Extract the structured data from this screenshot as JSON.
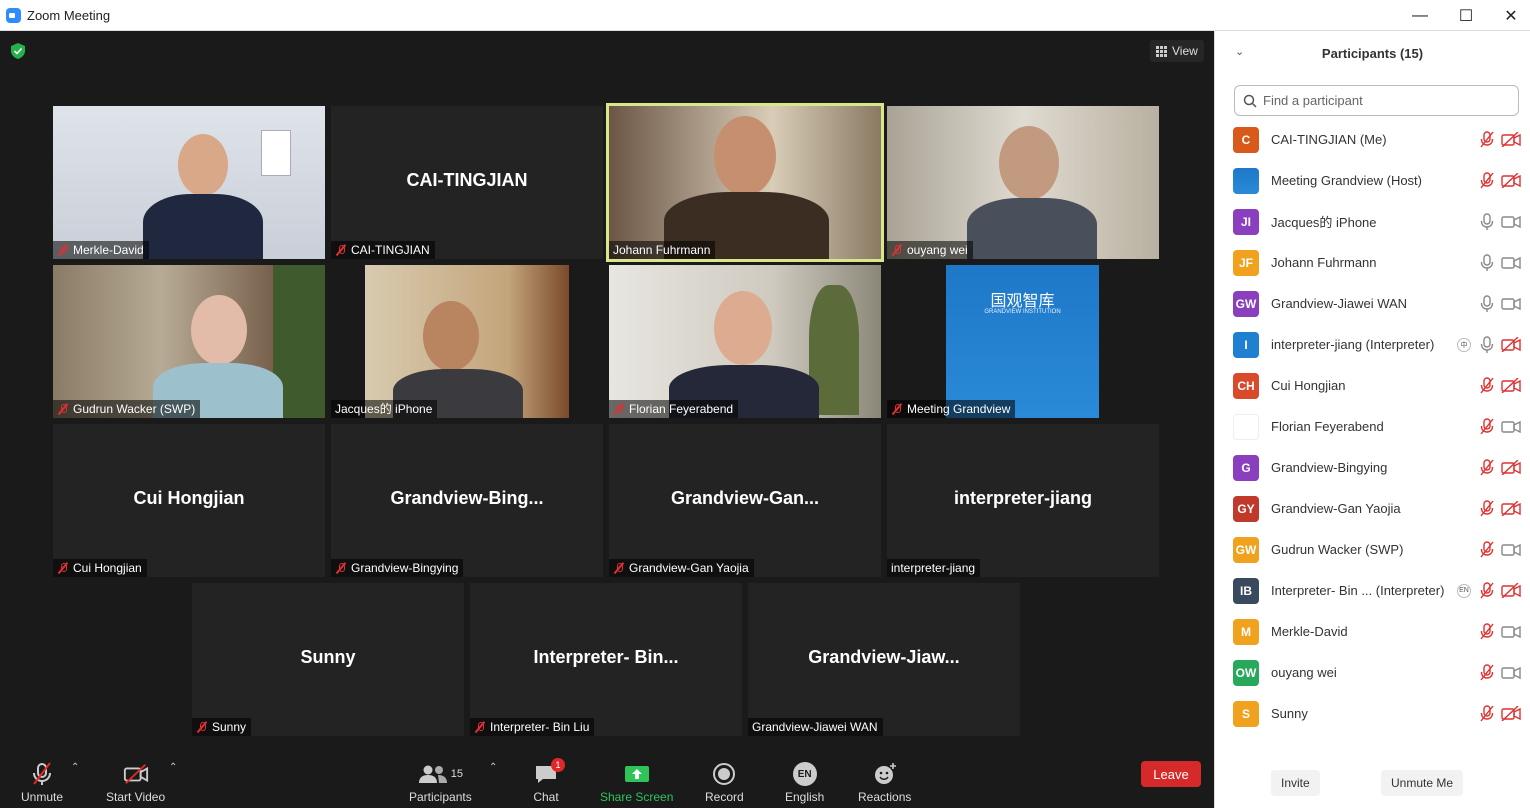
{
  "window": {
    "title": "Zoom Meeting"
  },
  "view": {
    "label": "View"
  },
  "tiles": [
    {
      "label": "Merkle-David",
      "big": ""
    },
    {
      "label": "CAI-TINGJIAN",
      "big": "CAI-TINGJIAN"
    },
    {
      "label": "Johann Fuhrmann",
      "big": ""
    },
    {
      "label": "ouyang wei",
      "big": ""
    },
    {
      "label": "Gudrun Wacker (SWP)",
      "big": ""
    },
    {
      "label": "Jacques的 iPhone",
      "big": ""
    },
    {
      "label": "Florian Feyerabend",
      "big": ""
    },
    {
      "label": "Meeting  Grandview",
      "big": ""
    },
    {
      "label": "Cui Hongjian",
      "big": "Cui Hongjian"
    },
    {
      "label": "Grandview-Bingying",
      "big": "Grandview-Bing..."
    },
    {
      "label": "Grandview-Gan Yaojia",
      "big": "Grandview-Gan..."
    },
    {
      "label": "interpreter-jiang",
      "big": "interpreter-jiang"
    },
    {
      "label": "Sunny",
      "big": "Sunny"
    },
    {
      "label": "Interpreter- Bin Liu",
      "big": "Interpreter-  Bin..."
    },
    {
      "label": "Grandview-Jiawei WAN",
      "big": "Grandview-Jiaw..."
    }
  ],
  "logo": {
    "title": "国观智库",
    "subtitle": "GRANDVIEW INSTITUTION"
  },
  "toolbar": {
    "unmute": "Unmute",
    "start_video": "Start Video",
    "participants": "Participants",
    "participants_count": "15",
    "chat": "Chat",
    "chat_badge": "1",
    "share": "Share Screen",
    "record": "Record",
    "english": "English",
    "english_icon": "EN",
    "reactions": "Reactions",
    "leave": "Leave"
  },
  "panel": {
    "title": "Participants (15)",
    "search_placeholder": "Find a participant",
    "invite": "Invite",
    "unmute_me": "Unmute Me",
    "participants": [
      {
        "initials": "C",
        "name": "CAI-TINGJIAN (Me)",
        "color": "#d9591b",
        "mic": "off",
        "cam": "off"
      },
      {
        "initials": "",
        "name": "Meeting  Grandview (Host)",
        "color": "#1f6fb5",
        "mic": "off",
        "cam": "off"
      },
      {
        "initials": "JI",
        "name": "Jacques的 iPhone",
        "color": "#8a3fbf",
        "mic": "on",
        "cam": "on"
      },
      {
        "initials": "JF",
        "name": "Johann Fuhrmann",
        "color": "#f0a21e",
        "mic": "on",
        "cam": "on"
      },
      {
        "initials": "GW",
        "name": "Grandview-Jiawei WAN",
        "color": "#8a3fbf",
        "mic": "on",
        "cam": "on"
      },
      {
        "initials": "I",
        "name": "interpreter-jiang (Interpreter)",
        "color": "#1f7fd1",
        "mic": "on",
        "cam": "off",
        "lang": "中"
      },
      {
        "initials": "CH",
        "name": "Cui Hongjian",
        "color": "#d94a2b",
        "mic": "off",
        "cam": "off"
      },
      {
        "initials": "",
        "name": "Florian Feyerabend",
        "color": "#ffffff",
        "mic": "off",
        "cam": "on"
      },
      {
        "initials": "G",
        "name": "Grandview-Bingying",
        "color": "#8a3fbf",
        "mic": "off",
        "cam": "off"
      },
      {
        "initials": "GY",
        "name": "Grandview-Gan Yaojia",
        "color": "#c0392b",
        "mic": "off",
        "cam": "off"
      },
      {
        "initials": "GW",
        "name": "Gudrun Wacker (SWP)",
        "color": "#f0a21e",
        "mic": "off",
        "cam": "on"
      },
      {
        "initials": "IB",
        "name": "Interpreter- Bin ...  (Interpreter)",
        "color": "#3a4a5e",
        "mic": "off",
        "cam": "off",
        "lang": "EN"
      },
      {
        "initials": "M",
        "name": "Merkle-David",
        "color": "#f0a21e",
        "mic": "off",
        "cam": "on"
      },
      {
        "initials": "OW",
        "name": "ouyang wei",
        "color": "#27a85a",
        "mic": "off",
        "cam": "on"
      },
      {
        "initials": "S",
        "name": "Sunny",
        "color": "#f0a21e",
        "mic": "off",
        "cam": "off"
      }
    ]
  }
}
